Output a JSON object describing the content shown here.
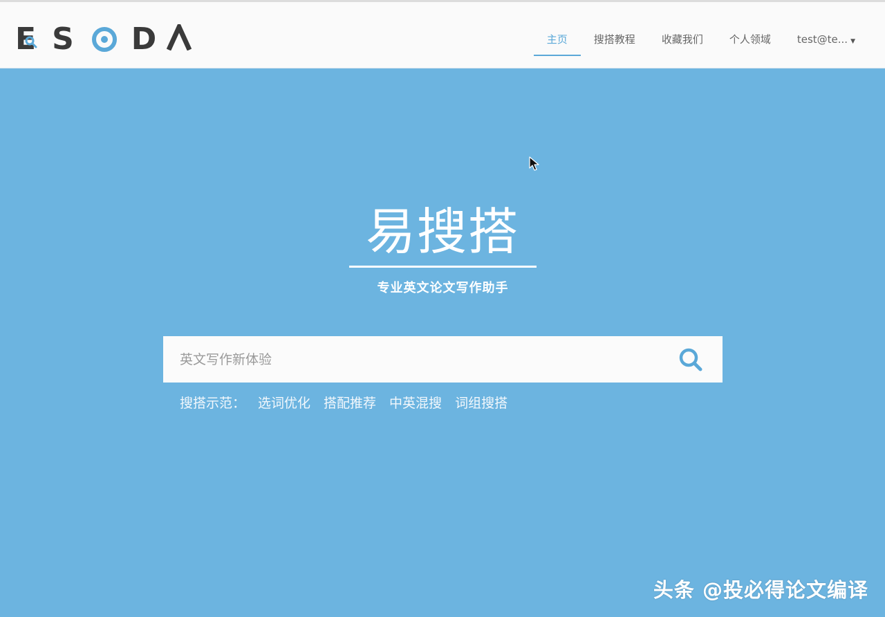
{
  "header": {
    "logo_text": "ESODA",
    "nav": [
      {
        "label": "主页",
        "active": true
      },
      {
        "label": "搜搭教程",
        "active": false
      },
      {
        "label": "收藏我们",
        "active": false
      },
      {
        "label": "个人领域",
        "active": false
      },
      {
        "label": "test@te...",
        "active": false
      }
    ]
  },
  "hero": {
    "title": "易搜搭",
    "subtitle": "专业英文论文写作助手"
  },
  "search": {
    "placeholder": "英文写作新体验",
    "value": ""
  },
  "examples": {
    "label": "搜搭示范：",
    "links": [
      "选词优化",
      "搭配推荐",
      "中英混搜",
      "词组搜搭"
    ]
  },
  "watermark": "头条 @投必得论文编译",
  "colors": {
    "background": "#6cb4e0",
    "accent": "#5aa8d8",
    "logo_dark": "#3a3a3a"
  },
  "icons": {
    "search": "search-icon",
    "dropdown": "caret-down-icon",
    "cursor": "mouse-cursor-icon"
  }
}
